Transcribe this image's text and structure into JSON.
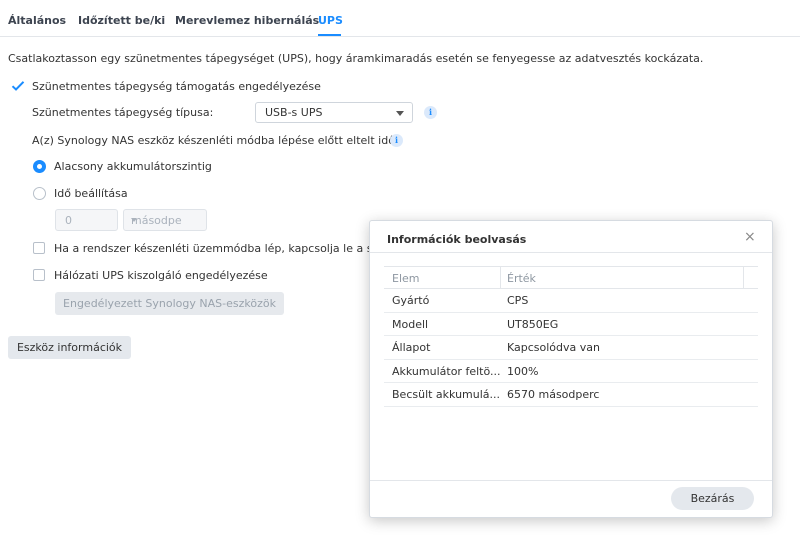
{
  "tabs": [
    {
      "label": "Általános"
    },
    {
      "label": "Időzített be/ki"
    },
    {
      "label": "Merevlemez hibernálás"
    },
    {
      "label": "UPS"
    }
  ],
  "intro_text": "Csatlakoztasson egy szünetmentes tápegységet (UPS), hogy áramkimaradás esetén se fenyegesse az adatvesztés kockázata.",
  "enable_ups_label": "Szünetmentes tápegység támogatás engedélyezése",
  "ups_type_label": "Szünetmentes tápegység típusa:",
  "ups_type_value": "USB-s UPS",
  "standby_time_label": "A(z) Synology NAS eszköz készenléti módba lépése előtt eltelt idő",
  "radio_low_battery": "Alacsony akkumulátorszintig",
  "radio_set_time": "Idő beállítása",
  "time_value": "0",
  "time_unit": "másodpe",
  "shutdown_checkbox_label": "Ha a rendszer készenléti üzemmódba lép, kapcsolja le a szü",
  "network_ups_label": "Hálózati UPS kiszolgáló engedélyezése",
  "permitted_devices_button": "Engedélyezett Synology NAS-eszközök",
  "device_info_button": "Eszköz információk",
  "info_icon_glyph": "i",
  "dialog": {
    "title": "Információk beolvasás",
    "close_glyph": "×",
    "col_item": "Elem",
    "col_value": "Érték",
    "rows": [
      {
        "item": "Gyártó",
        "value": "CPS"
      },
      {
        "item": "Modell",
        "value": "UT850EG"
      },
      {
        "item": "Állapot",
        "value": "Kapcsolódva van"
      },
      {
        "item": "Akkumulátor feltö...",
        "value": "100%"
      },
      {
        "item": "Becsült akkumulá...",
        "value": "6570 másodperc"
      }
    ],
    "close_button": "Bezárás"
  },
  "colors": {
    "accent": "#1a8cff"
  }
}
